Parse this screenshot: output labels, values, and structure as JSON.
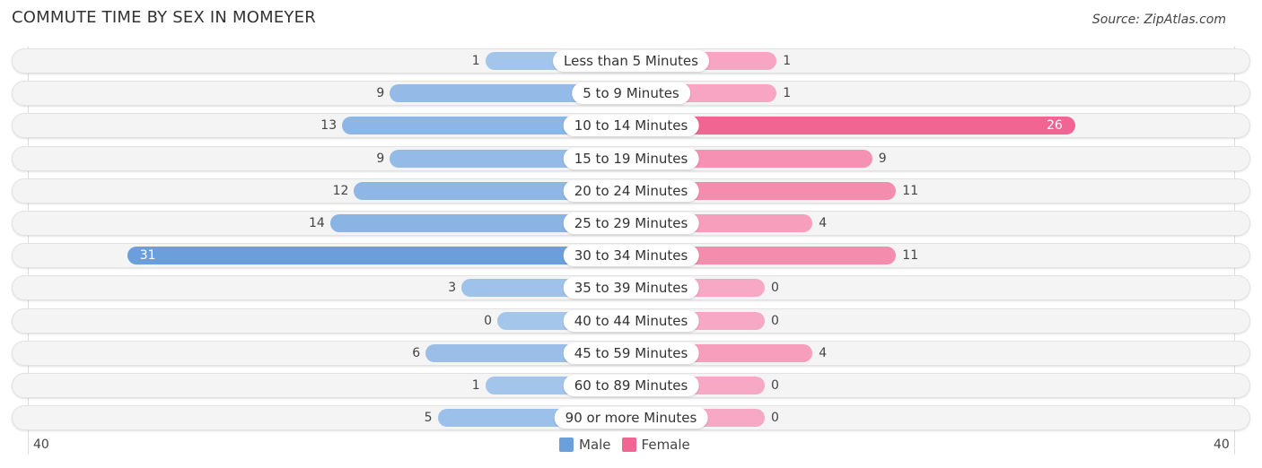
{
  "title": "COMMUTE TIME BY SEX IN MOMEYER",
  "source": "Source: ZipAtlas.com",
  "chart_data": {
    "type": "bar",
    "orientation": "horizontal-diverging",
    "title": "COMMUTE TIME BY SEX IN MOMEYER",
    "categories": [
      "Less than 5 Minutes",
      "5 to 9 Minutes",
      "10 to 14 Minutes",
      "15 to 19 Minutes",
      "20 to 24 Minutes",
      "25 to 29 Minutes",
      "30 to 34 Minutes",
      "35 to 39 Minutes",
      "40 to 44 Minutes",
      "45 to 59 Minutes",
      "60 to 89 Minutes",
      "90 or more Minutes"
    ],
    "series": [
      {
        "name": "Male",
        "color": "#6a9fdc",
        "values": [
          1,
          9,
          13,
          9,
          12,
          14,
          31,
          3,
          0,
          6,
          1,
          5
        ]
      },
      {
        "name": "Female",
        "color": "#f06591",
        "values": [
          1,
          1,
          26,
          9,
          11,
          4,
          11,
          0,
          0,
          4,
          0,
          0
        ]
      }
    ],
    "axis": {
      "left_label": "40",
      "right_label": "40",
      "range": [
        -40,
        40
      ]
    },
    "legend": [
      {
        "label": "Male",
        "color": "#6a9fdc"
      },
      {
        "label": "Female",
        "color": "#f06591"
      }
    ],
    "legend_position": "bottom-center"
  }
}
